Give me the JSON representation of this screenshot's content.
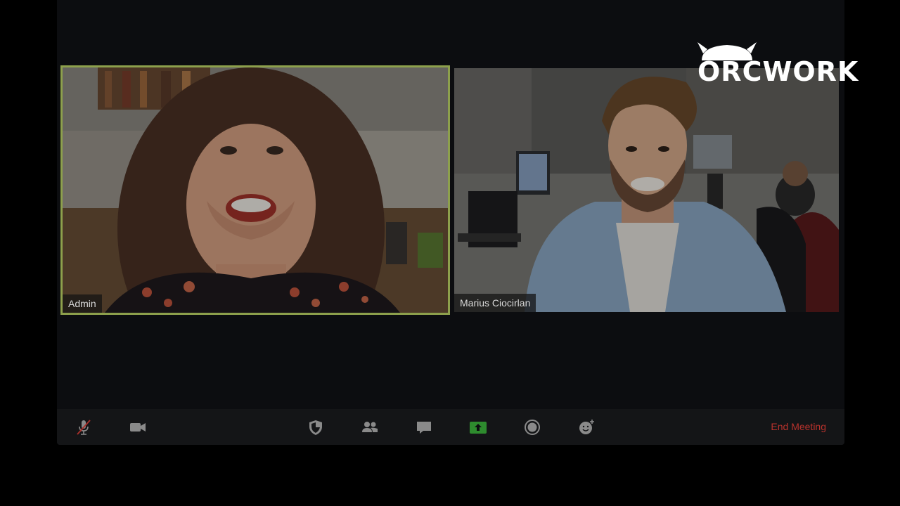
{
  "participants": [
    {
      "name": "Admin",
      "active_speaker": true
    },
    {
      "name": "Marius Ciocirlan",
      "active_speaker": false
    }
  ],
  "toolbar": {
    "items": [
      {
        "icon": "muted-microphone-icon"
      },
      {
        "icon": "video-camera-icon"
      },
      {
        "icon": "security-shield-icon"
      },
      {
        "icon": "participants-icon"
      },
      {
        "icon": "chat-icon"
      },
      {
        "icon": "share-screen-icon"
      },
      {
        "icon": "record-icon"
      },
      {
        "icon": "reactions-icon"
      }
    ],
    "end_meeting_label": "End Meeting"
  },
  "logo": {
    "text": "ORCWORK"
  },
  "colors": {
    "active_speaker_border": "#8da04c",
    "share_screen_green": "#2e8b2e",
    "end_meeting_red": "#b7322c"
  }
}
